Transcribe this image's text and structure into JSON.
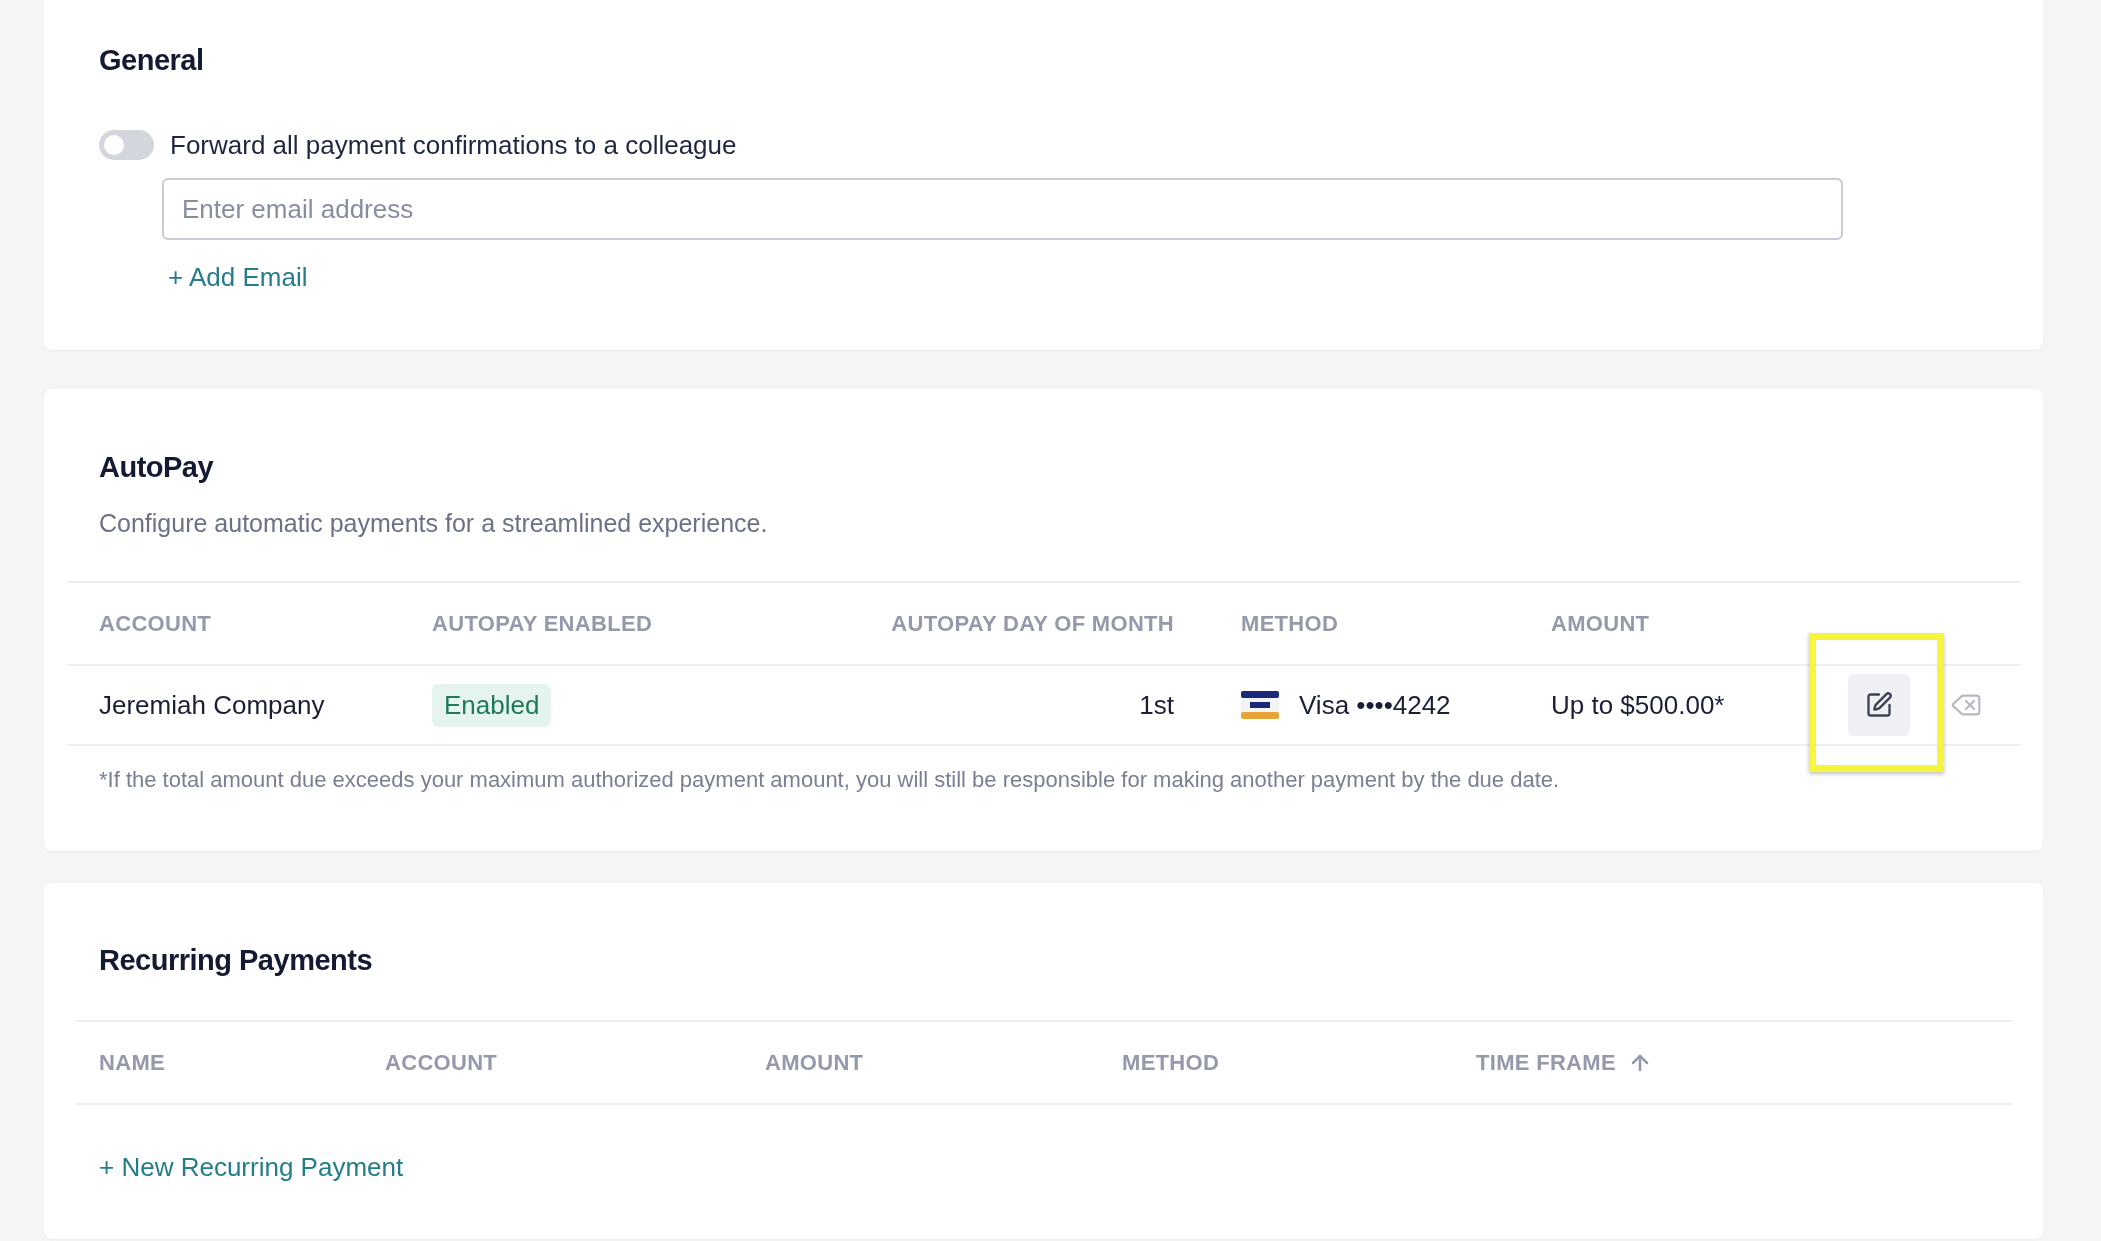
{
  "general": {
    "title": "General",
    "forward_toggle": {
      "label": "Forward all payment confirmations to a colleague",
      "on": false
    },
    "email_field": {
      "placeholder": "Enter email address"
    },
    "add_email_link": "+ Add Email"
  },
  "autopay": {
    "title": "AutoPay",
    "subtitle": "Configure automatic payments for a streamlined experience.",
    "table": {
      "columns": [
        "ACCOUNT",
        "AUTOPAY ENABLED",
        "AUTOPAY DAY OF MONTH",
        "METHOD",
        "AMOUNT"
      ],
      "rows": [
        {
          "account": "Jeremiah Company",
          "status": {
            "label": "Enabled",
            "enabled": true
          },
          "day_of_month": "1st",
          "method": "Visa ••••4242",
          "amount": "Up to $500.00*",
          "edit_highlighted": true
        }
      ]
    },
    "footnote": "*If the total amount due exceeds your maximum authorized payment amount, you will still be responsible for making another payment by the due date."
  },
  "recurring_payments": {
    "title": "Recurring Payments",
    "table": {
      "columns": [
        {
          "label": "NAME",
          "sorted": false
        },
        {
          "label": "ACCOUNT",
          "sorted": false
        },
        {
          "label": "AMOUNT",
          "sorted": false
        },
        {
          "label": "METHOD",
          "sorted": false
        },
        {
          "label": "TIME FRAME",
          "sorted": true
        }
      ]
    },
    "new_link": "+ New Recurring Payment"
  }
}
